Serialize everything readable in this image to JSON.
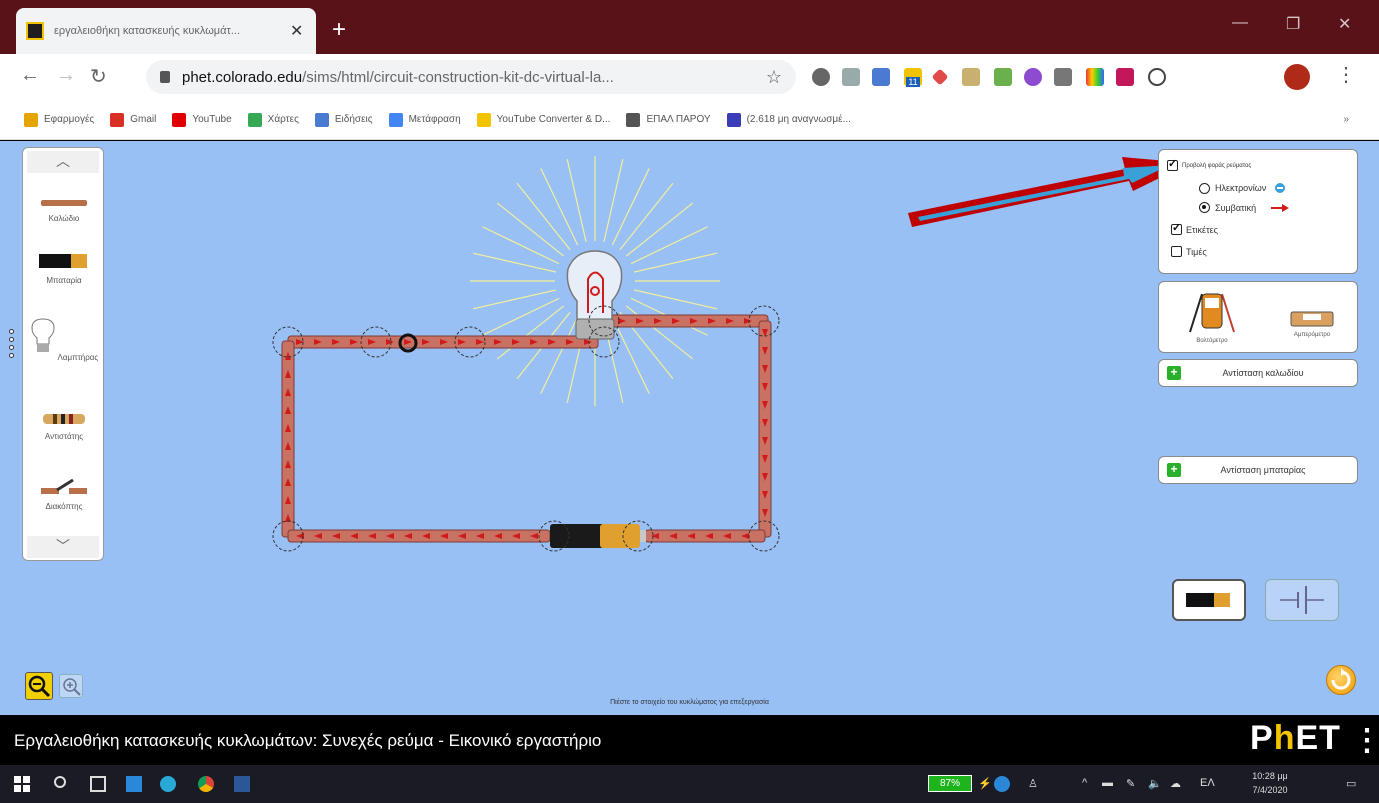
{
  "browser": {
    "tab_title": "εργαλειοθήκη κατασκευής κυκλωμάτ...",
    "tab_close": "✕",
    "new_tab": "+",
    "url_host": "phet.colorado.edu",
    "url_path": "/sims/html/circuit-construction-kit-dc-virtual-la...",
    "ext_badge": "11",
    "bookmarks": [
      {
        "label": "Εφαρμογές",
        "color": "#e5a500"
      },
      {
        "label": "Gmail",
        "color": "#d93025"
      },
      {
        "label": "YouTube",
        "color": "#e00000"
      },
      {
        "label": "Χάρτες",
        "color": "#34a853"
      },
      {
        "label": "Ειδήσεις",
        "color": "#4a7bd0"
      },
      {
        "label": "Μετάφραση",
        "color": "#4285f4"
      },
      {
        "label": "YouTube Converter & D...",
        "color": "#f2c300"
      },
      {
        "label": "ΕΠΑΛ ΠΑΡΟΥ",
        "color": "#555555"
      },
      {
        "label": "(2.618 μη αναγνωσμέ...",
        "color": "#3b3db8"
      }
    ],
    "bookmarks_more": "»"
  },
  "sim": {
    "toolbox": [
      {
        "label": "Καλώδιο",
        "icon": "wire-icon"
      },
      {
        "label": "Μπαταρία",
        "icon": "battery-icon"
      },
      {
        "label": "Λαμπτήρας",
        "icon": "light-bulb-icon"
      },
      {
        "label": "Αντιστάτης",
        "icon": "resistor-icon"
      },
      {
        "label": "Διακόπτης",
        "icon": "switch-icon"
      }
    ],
    "view": {
      "current_flow": "Προβολή φοράς ρεύματος",
      "electrons": "Ηλεκτρονίων",
      "conventional": "Συμβατική",
      "labels": "Ετικέτες",
      "values": "Τιμές",
      "current_flow_checked": true,
      "electrons_selected": false,
      "conventional_selected": true,
      "labels_checked": true,
      "values_checked": false
    },
    "tools": {
      "voltmeter": "Βολτόμετρο",
      "ammeter": "Αμπερόμετρο"
    },
    "wire_resistance": "Αντίσταση καλωδίου",
    "battery_resistance": "Αντίσταση μπαταρίας",
    "hint": "Πιέστε το στοιχείο του κυκλώματος για επεξεργασία"
  },
  "phet_bar": {
    "title": "Εργαλειοθήκη κατασκευής κυκλωμάτων: Συνεχές ρεύμα - Εικονικό εργαστήριο",
    "logo": "PhET",
    "menu": "⋮"
  },
  "taskbar": {
    "battery": "87%",
    "lang": "ΕΛ",
    "time": "10:28 μμ",
    "date": "7/4/2020"
  },
  "colors": {
    "sim_bg": "#99c0f5",
    "wire": "#c97264",
    "current_arrow": "#d11a1a",
    "annotation_arrow": "#c00000",
    "annotation_arrow_inner": "#3aa0d8"
  }
}
